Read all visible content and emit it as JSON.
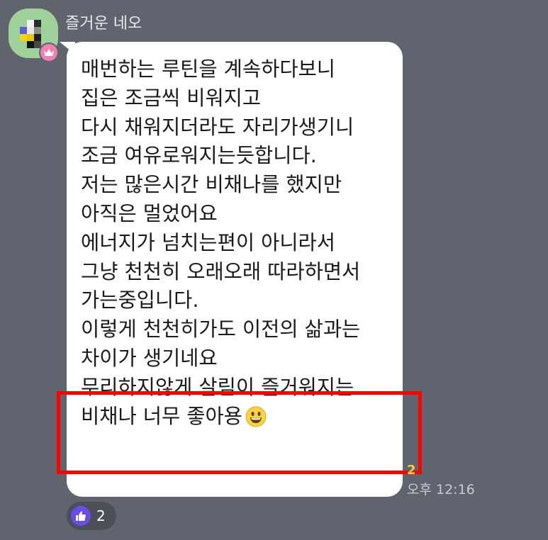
{
  "chat": {
    "sender_name": "즐거운 네오",
    "message_lines": [
      "매번하는 루틴을 계속하다보니",
      "집은 조금씩 비워지고",
      "다시 채워지더라도 자리가생기니",
      "조금 여유로워지는듯합니다.",
      "저는 많은시간 비채나를 했지만",
      "아직은 멀었어요",
      "에너지가 넘치는편이 아니라서",
      "그냥 천천히 오래오래 따라하면서",
      "가는중입니다.",
      "이렇게 천천히가도 이전의 삶과는",
      "차이가 생기네요",
      "무리하지않게 살림이 즐거워지는",
      "비채나 너무 좋아용"
    ],
    "emoji_name": "grinning-face-emoji",
    "unread_count": "2",
    "timestamp": "오후 12:16",
    "reaction": {
      "icon": "thumbs-up-icon",
      "count": "2"
    }
  },
  "colors": {
    "background": "#5f646e",
    "bubble": "#ffffff",
    "highlight": "#ff0000",
    "unread": "#f5d33b",
    "reaction_icon": "#6b4ce6",
    "avatar_bg": "#9fd19a",
    "crown_badge": "#f07fb4"
  }
}
